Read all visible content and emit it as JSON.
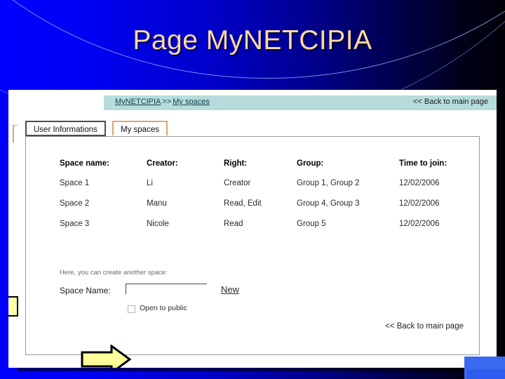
{
  "slide": {
    "title": "Page MyNETCIPIA",
    "title_color": "#fbd9a0",
    "bg_start_color": "#0000ff",
    "bg_end_color": "#000008"
  },
  "screenshot": {
    "breadcrumb": {
      "root_label": "MyNETCIPIA",
      "separator": ">>",
      "current_label": "My spaces",
      "bar_color": "#b6dcdc"
    },
    "back_to_main_top": "<< Back to main page",
    "back_to_main_bottom": "<< Back to main page",
    "tabs": [
      {
        "label": "User Informations",
        "active": false,
        "border_color": "#4d4d4d"
      },
      {
        "label": "My spaces",
        "active": true,
        "border_color": "#d5a96a"
      }
    ],
    "spaces_table": {
      "headers": [
        "Space name:",
        "Creator:",
        "Right:",
        "Group:",
        "Time to join:"
      ],
      "rows": [
        {
          "space_name": "Space 1",
          "creator": "Li",
          "right": "Creator",
          "group": "Group 1, Group 2",
          "time_to_join": "12/02/2006"
        },
        {
          "space_name": "Space 2",
          "creator": "Manu",
          "right": "Read, Edit",
          "group": "Group 4, Group 3",
          "time_to_join": "12/02/2006"
        },
        {
          "space_name": "Space 3",
          "creator": "Nicole",
          "right": "Read",
          "group": "Group 5",
          "time_to_join": "12/02/2006"
        }
      ]
    },
    "create_space": {
      "hint": "Here, you can create another space:",
      "name_label": "Space Name:",
      "name_value": "",
      "name_placeholder": "",
      "new_button_label": "New",
      "open_to_public_label": "Open to public",
      "open_to_public_checked": false
    },
    "annotations": {
      "arrow_color": "#ffff99",
      "arrow_target": "open-to-public-checkbox",
      "marker_color": "#ffffa8"
    }
  }
}
